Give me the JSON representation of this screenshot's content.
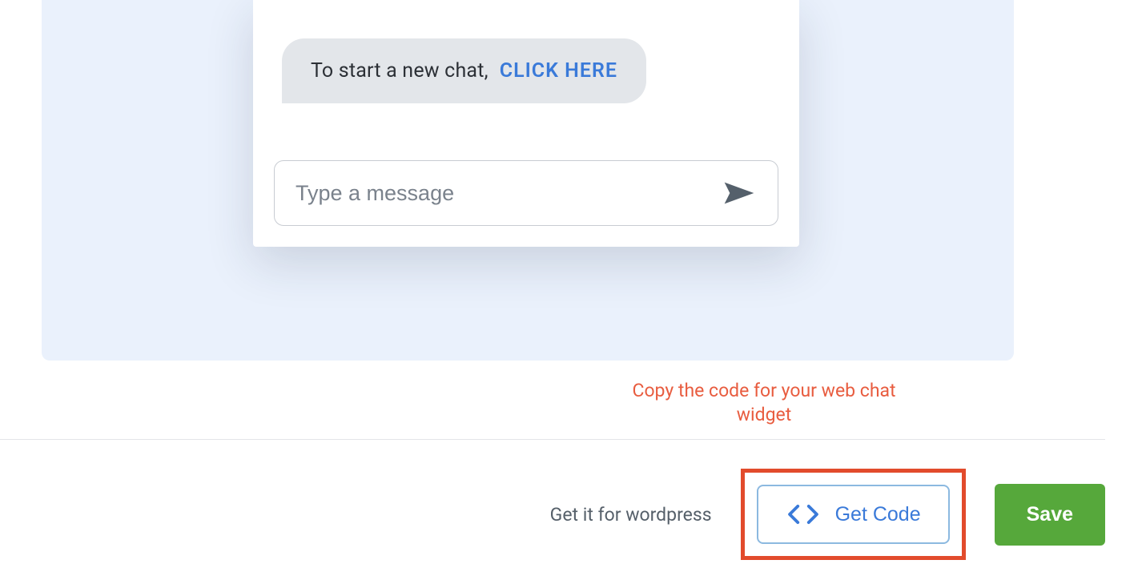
{
  "chat": {
    "bubble_text": "To start a new chat,",
    "bubble_link": "CLICK HERE",
    "input_placeholder": "Type a message"
  },
  "helper": {
    "text": "Copy the code for your web chat widget"
  },
  "footer": {
    "wordpress_link": "Get it for wordpress",
    "getcode_label": "Get Code",
    "save_label": "Save"
  },
  "colors": {
    "accent_blue": "#3a7ad9",
    "panel_bg": "#eaf1fc",
    "highlight_red": "#e24b2c",
    "save_green": "#56a83b"
  }
}
